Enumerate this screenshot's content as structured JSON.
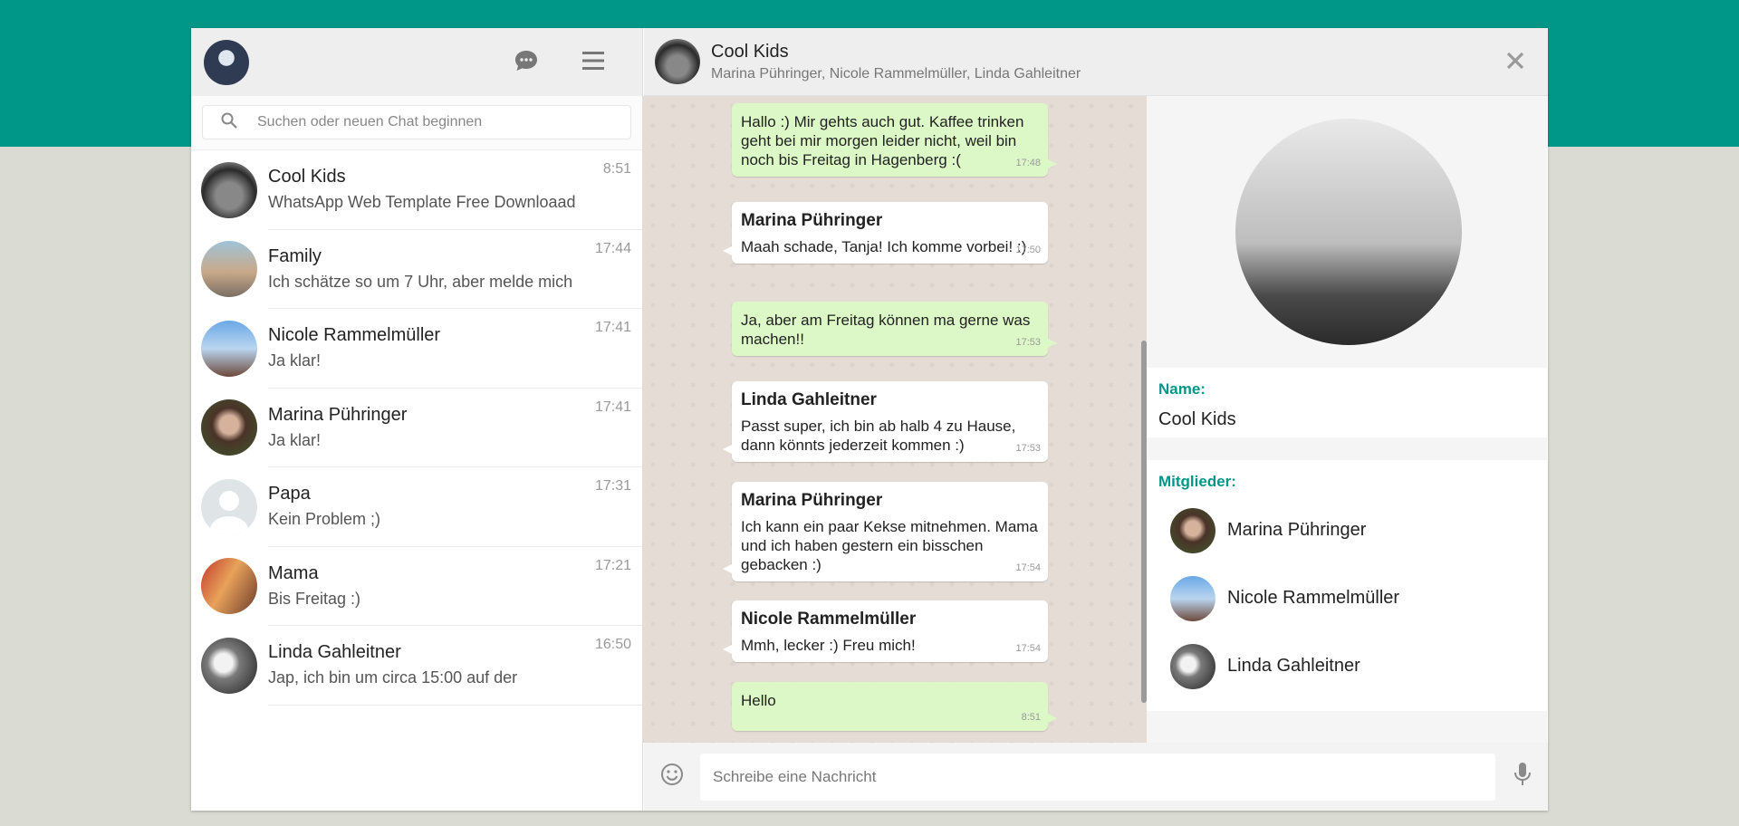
{
  "sidebar": {
    "search_placeholder": "Suchen oder neuen Chat beginnen",
    "chats": [
      {
        "name": "Cool Kids",
        "preview": "WhatsApp Web Template Free Downloaad",
        "time": "8:51"
      },
      {
        "name": "Family",
        "preview": "Ich schätze so um 7 Uhr, aber melde mich",
        "time": "17:44"
      },
      {
        "name": "Nicole Rammelmüller",
        "preview": "Ja klar!",
        "time": "17:41"
      },
      {
        "name": "Marina Pühringer",
        "preview": "Ja klar!",
        "time": "17:41"
      },
      {
        "name": "Papa",
        "preview": "Kein Problem ;)",
        "time": "17:31"
      },
      {
        "name": "Mama",
        "preview": "Bis Freitag :)",
        "time": "17:21"
      },
      {
        "name": "Linda Gahleitner",
        "preview": "Jap, ich bin um circa 15:00 auf der",
        "time": "16:50"
      }
    ]
  },
  "conversation": {
    "title": "Cool Kids",
    "members": "Marina Pühringer, Nicole Rammelmüller, Linda Gahleitner",
    "messages": [
      {
        "direction": "out",
        "text": "Hallo :) Mir gehts auch gut. Kaffee trinken geht bei mir morgen leider nicht, weil bin noch bis Freitag in Hagenberg :(",
        "time": "17:48"
      },
      {
        "direction": "in",
        "sender": "Marina Pühringer",
        "text": "Maah schade, Tanja! Ich komme vorbei! :)",
        "time": "17:50"
      },
      {
        "direction": "out",
        "text": "Ja, aber am Freitag können ma gerne was machen!!",
        "time": "17:53"
      },
      {
        "direction": "in",
        "sender": "Linda Gahleitner",
        "text": "Passt super, ich bin ab halb 4 zu Hause, dann könnts jederzeit kommen :)",
        "time": "17:53"
      },
      {
        "direction": "in",
        "sender": "Marina Pühringer",
        "text": "Ich kann ein paar Kekse mitnehmen. Mama und ich haben gestern ein bisschen gebacken :)",
        "time": "17:54"
      },
      {
        "direction": "in",
        "sender": "Nicole Rammelmüller",
        "text": "Mmh, lecker :) Freu mich!",
        "time": "17:54"
      },
      {
        "direction": "out",
        "text": "Hello",
        "time": "8:51"
      }
    ],
    "composer_placeholder": "Schreibe eine Nachricht"
  },
  "group_info": {
    "name_label": "Name:",
    "name_value": "Cool Kids",
    "members_label": "Mitglieder:",
    "members": [
      "Marina Pühringer",
      "Nicole Rammelmüller",
      "Linda Gahleitner"
    ]
  },
  "colors": {
    "accent": "#009688",
    "outgoing_bubble": "#dcf8c6",
    "chat_background": "#e5ddd5"
  },
  "icons": [
    "chat-icon",
    "menu-icon",
    "search-icon",
    "close-icon",
    "emoji-icon",
    "microphone-icon"
  ]
}
